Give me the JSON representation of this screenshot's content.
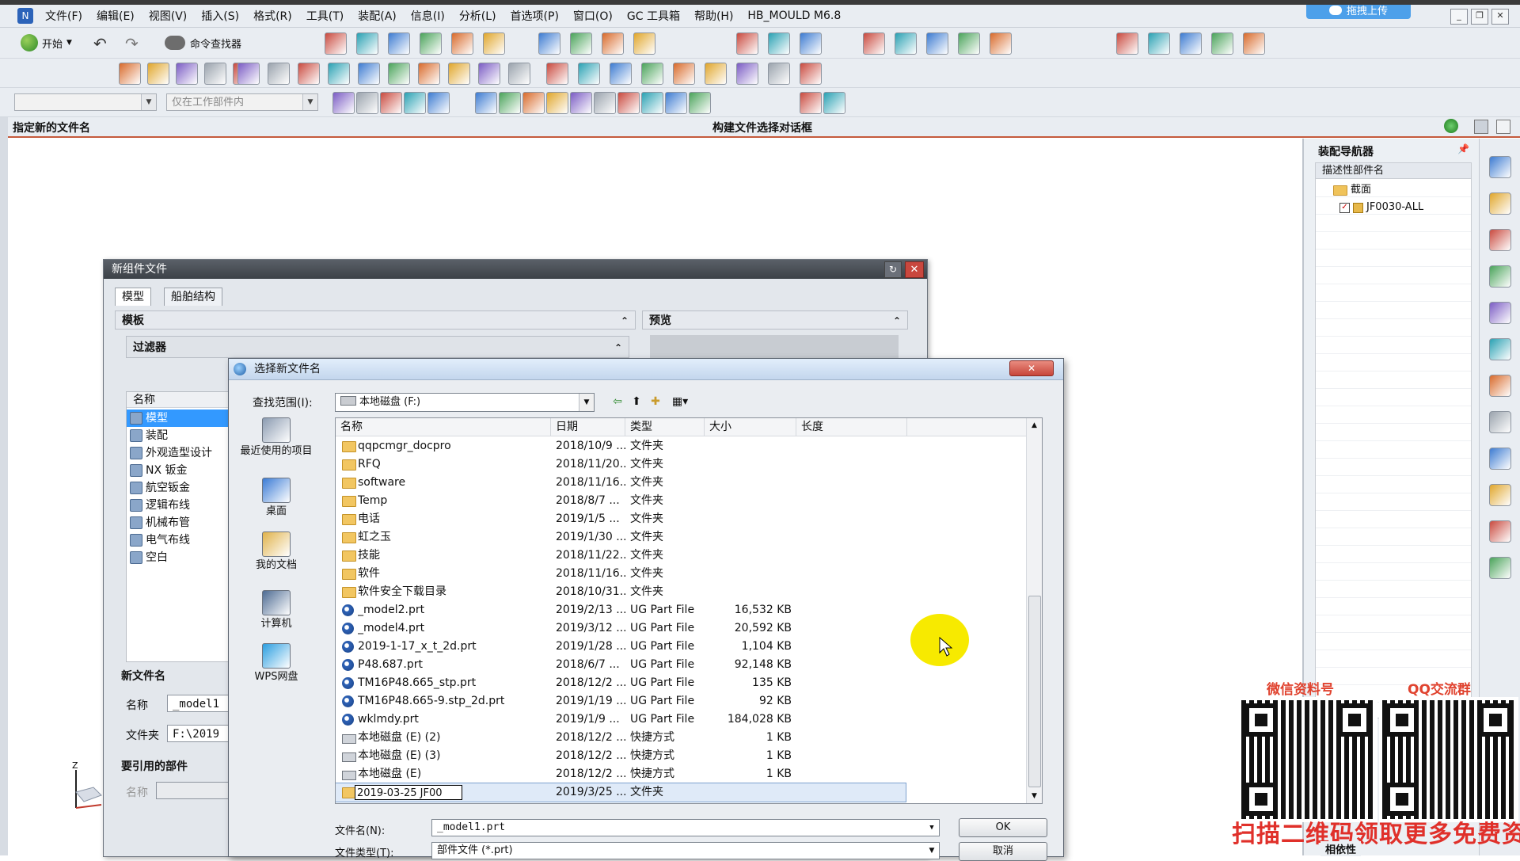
{
  "menubar": {
    "items": [
      "文件(F)",
      "编辑(E)",
      "视图(V)",
      "插入(S)",
      "格式(R)",
      "工具(T)",
      "装配(A)",
      "信息(I)",
      "分析(L)",
      "首选项(P)",
      "窗口(O)",
      "GC 工具箱",
      "帮助(H)",
      "HB_MOULD M6.8"
    ],
    "upload_label": "拖拽上传"
  },
  "toolbar": {
    "start_label": "开始",
    "command_finder_label": "命令查找器",
    "filter_combo_value": "",
    "scope_combo_value": "仅在工作部件内"
  },
  "cue_line": {
    "prompt": "指定新的文件名",
    "status": "构建文件选择对话框"
  },
  "assembly_navigator": {
    "title": "装配导航器",
    "column_header": "描述性部件名",
    "items": [
      {
        "label": "截面",
        "type": "folder"
      },
      {
        "label": "JF0030-ALL",
        "type": "part",
        "checked": true
      }
    ],
    "bottom_label": "相依性"
  },
  "new_component_dialog": {
    "title": "新组件文件",
    "tabs": [
      "模型",
      "船舶结构"
    ],
    "template_section": "模板",
    "preview_section": "预览",
    "filter_section": "过滤器",
    "list_header": "名称",
    "templates": [
      "模型",
      "装配",
      "外观造型设计",
      "NX 钣金",
      "航空钣金",
      "逻辑布线",
      "机械布管",
      "电气布线",
      "空白"
    ],
    "selected_template": "模型",
    "new_file_section": "新文件名",
    "name_label": "名称",
    "name_value": "_model1",
    "folder_label": "文件夹",
    "folder_value": "F:\\2019",
    "ref_parts_section": "要引用的部件",
    "ref_name_label": "名称"
  },
  "file_dialog": {
    "title": "选择新文件名",
    "look_in_label": "查找范围(I):",
    "look_in_value": "本地磁盘 (F:)",
    "places": [
      "最近使用的项目",
      "桌面",
      "我的文档",
      "计算机",
      "WPS网盘"
    ],
    "columns": [
      "名称",
      "日期",
      "类型",
      "大小",
      "长度"
    ],
    "rows": [
      {
        "name": "qqpcmgr_docpro",
        "date": "2018/10/9 ...",
        "type": "文件夹",
        "size": "",
        "kind": "folder"
      },
      {
        "name": "RFQ",
        "date": "2018/11/20...",
        "type": "文件夹",
        "size": "",
        "kind": "folder"
      },
      {
        "name": "software",
        "date": "2018/11/16...",
        "type": "文件夹",
        "size": "",
        "kind": "folder"
      },
      {
        "name": "Temp",
        "date": "2018/8/7 ...",
        "type": "文件夹",
        "size": "",
        "kind": "folder"
      },
      {
        "name": "电话",
        "date": "2019/1/5 ...",
        "type": "文件夹",
        "size": "",
        "kind": "folder"
      },
      {
        "name": "虹之玉",
        "date": "2019/1/30 ...",
        "type": "文件夹",
        "size": "",
        "kind": "folder"
      },
      {
        "name": "技能",
        "date": "2018/11/22...",
        "type": "文件夹",
        "size": "",
        "kind": "folder"
      },
      {
        "name": "软件",
        "date": "2018/11/16...",
        "type": "文件夹",
        "size": "",
        "kind": "folder"
      },
      {
        "name": "软件安全下载目录",
        "date": "2018/10/31...",
        "type": "文件夹",
        "size": "",
        "kind": "folder"
      },
      {
        "name": "_model2.prt",
        "date": "2019/2/13 ...",
        "type": "UG Part File",
        "size": "16,532 KB",
        "kind": "prt"
      },
      {
        "name": "_model4.prt",
        "date": "2019/3/12 ...",
        "type": "UG Part File",
        "size": "20,592 KB",
        "kind": "prt"
      },
      {
        "name": "2019-1-17_x_t_2d.prt",
        "date": "2019/1/28 ...",
        "type": "UG Part File",
        "size": "1,104 KB",
        "kind": "prt"
      },
      {
        "name": "P48.687.prt",
        "date": "2018/6/7 ...",
        "type": "UG Part File",
        "size": "92,148 KB",
        "kind": "prt"
      },
      {
        "name": "TM16P48.665_stp.prt",
        "date": "2018/12/2 ...",
        "type": "UG Part File",
        "size": "135 KB",
        "kind": "prt"
      },
      {
        "name": "TM16P48.665-9.stp_2d.prt",
        "date": "2019/1/19 ...",
        "type": "UG Part File",
        "size": "92 KB",
        "kind": "prt"
      },
      {
        "name": "wklmdy.prt",
        "date": "2019/1/9 ...",
        "type": "UG Part File",
        "size": "184,028 KB",
        "kind": "prt"
      },
      {
        "name": "本地磁盘 (E) (2)",
        "date": "2018/12/2 ...",
        "type": "快捷方式",
        "size": "1 KB",
        "kind": "lnk"
      },
      {
        "name": "本地磁盘 (E) (3)",
        "date": "2018/12/2 ...",
        "type": "快捷方式",
        "size": "1 KB",
        "kind": "lnk"
      },
      {
        "name": "本地磁盘 (E)",
        "date": "2018/12/2 ...",
        "type": "快捷方式",
        "size": "1 KB",
        "kind": "lnk"
      },
      {
        "name": "2019-03-25 JF00",
        "date": "2019/3/25 ...",
        "type": "文件夹",
        "size": "",
        "kind": "folder",
        "editing": true
      }
    ],
    "filename_label": "文件名(N):",
    "filename_value": "_model1.prt",
    "filetype_label": "文件类型(T):",
    "filetype_value": "部件文件 (*.prt)",
    "ok_label": "OK",
    "cancel_label": "取消"
  },
  "watermark": {
    "label_left": "微信资料号",
    "label_right": "QQ交流群",
    "bottom_text": "扫描二维码领取更多免费资料"
  },
  "colors": {
    "accent_red": "#c55a3c",
    "selection": "#3399ff",
    "watermark_red": "#e0302a"
  }
}
